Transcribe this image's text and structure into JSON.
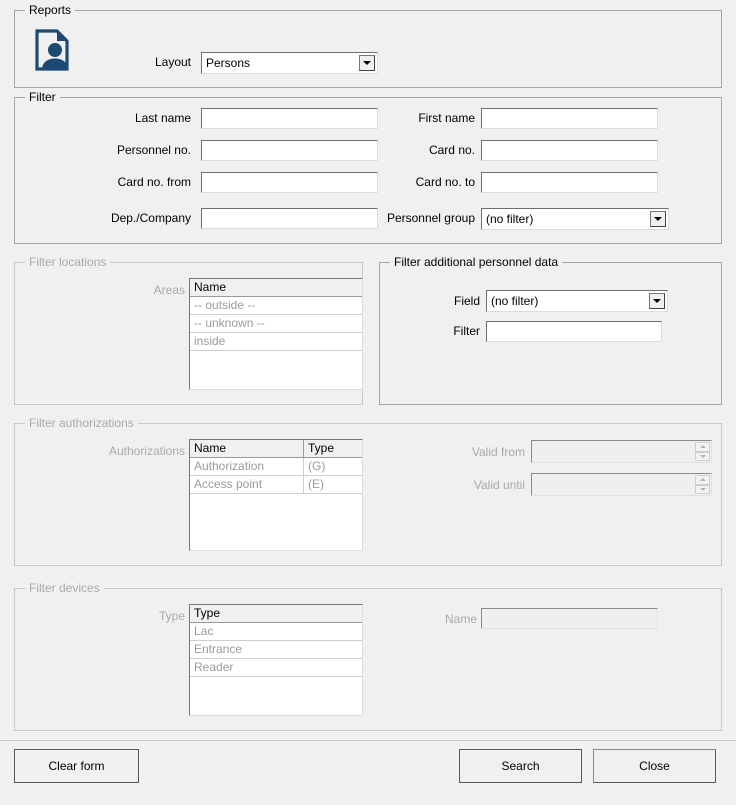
{
  "reports": {
    "title": "Reports",
    "icon": "report-person-icon",
    "layout_label": "Layout",
    "layout_value": "Persons",
    "layout_options": [
      "Persons"
    ]
  },
  "filter": {
    "title": "Filter",
    "fields": {
      "last_name_label": "Last name",
      "last_name_value": "",
      "first_name_label": "First name",
      "first_name_value": "",
      "personnel_no_label": "Personnel no.",
      "personnel_no_value": "",
      "card_no_label": "Card no.",
      "card_no_value": "",
      "card_no_from_label": "Card no. from",
      "card_no_from_value": "",
      "card_no_to_label": "Card no. to",
      "card_no_to_value": "",
      "dep_company_label": "Dep./Company",
      "dep_company_value": "",
      "personnel_group_label": "Personnel group",
      "personnel_group_value": "(no filter)",
      "personnel_group_options": [
        "(no filter)"
      ]
    }
  },
  "filter_locations": {
    "title": "Filter locations",
    "areas_label": "Areas",
    "columns": [
      "Name"
    ],
    "rows": [
      [
        "-- outside --"
      ],
      [
        "-- unknown --"
      ],
      [
        "inside"
      ]
    ]
  },
  "filter_additional": {
    "title": "Filter additional personnel data",
    "field_label": "Field",
    "field_value": "(no filter)",
    "field_options": [
      "(no filter)"
    ],
    "filter_label": "Filter",
    "filter_value": ""
  },
  "filter_authorizations": {
    "title": "Filter authorizations",
    "authorizations_label": "Authorizations",
    "columns": [
      "Name",
      "Type"
    ],
    "rows": [
      [
        "Authorization",
        "(G)"
      ],
      [
        "Access point",
        "(E)"
      ]
    ],
    "valid_from_label": "Valid from",
    "valid_from_value": "",
    "valid_until_label": "Valid until",
    "valid_until_value": ""
  },
  "filter_devices": {
    "title": "Filter devices",
    "type_label": "Type",
    "columns": [
      "Type"
    ],
    "rows": [
      [
        "Lac"
      ],
      [
        "Entrance"
      ],
      [
        "Reader"
      ]
    ],
    "name_label": "Name",
    "name_value": ""
  },
  "actions": {
    "clear_form": "Clear form",
    "search": "Search",
    "close": "Close"
  },
  "colors": {
    "background": "#f0f0f0",
    "icon_blue": "#1c4a72",
    "border": "#a6a6a6",
    "disabled_text": "#aaaaaa"
  }
}
